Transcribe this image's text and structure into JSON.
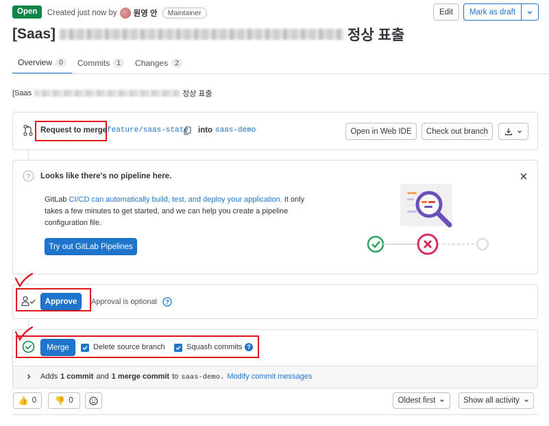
{
  "header": {
    "status": "Open",
    "created_text": "Created just now by",
    "author": "원영 안",
    "role_badge": "Maintainer",
    "edit_label": "Edit",
    "mark_draft_label": "Mark as draft",
    "title_prefix": "[Saas]",
    "title_suffix": "정상 표출"
  },
  "tabs": [
    {
      "label": "Overview",
      "count": "0"
    },
    {
      "label": "Commits",
      "count": "1"
    },
    {
      "label": "Changes",
      "count": "2"
    }
  ],
  "description": {
    "prefix": "[Saas",
    "suffix": "정상 표출"
  },
  "merge_request": {
    "request_label": "Request to merge",
    "source_branch": "feature/saas-state",
    "into_label": "into",
    "target_branch": "saas-demo",
    "open_ide_label": "Open in Web IDE",
    "checkout_label": "Check out branch"
  },
  "pipeline": {
    "title": "Looks like there's no pipeline here.",
    "body_pre": "GitLab ",
    "body_link": "CI/CD can automatically build, test, and deploy your application.",
    "body_post": " It only takes a few minutes to get started, and we can help you create a pipeline configuration file.",
    "button_label": "Try out GitLab Pipelines"
  },
  "approval": {
    "approve_label": "Approve",
    "optional_text": "Approval is optional"
  },
  "merge": {
    "merge_label": "Merge",
    "delete_source_label": "Delete source branch",
    "squash_label": "Squash commits",
    "help_glyph": "?",
    "adds_text_1": "Adds",
    "adds_commits": "1 commit",
    "adds_and": "and",
    "adds_merge_commit": "1 merge commit",
    "adds_to": "to",
    "adds_target": "saas-demo.",
    "modify_link": "Modify commit messages"
  },
  "reactions": {
    "thumbs_up_count": "0",
    "thumbs_down_count": "0",
    "sort_label": "Oldest first",
    "filter_label": "Show all activity"
  },
  "colors": {
    "primary": "#1f75cb",
    "success": "#108548",
    "danger": "#dd2b0e",
    "highlight": "#e0151e",
    "pipeline_purple": "#6b4fbb"
  }
}
